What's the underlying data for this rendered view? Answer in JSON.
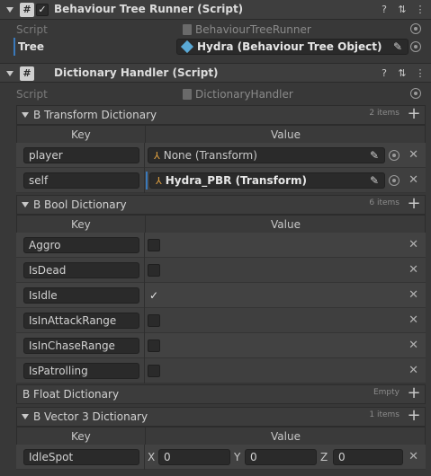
{
  "runner": {
    "title": "Behaviour Tree Runner (Script)",
    "script_label": "Script",
    "script_value": "BehaviourTreeRunner",
    "tree_label": "Tree",
    "tree_value": "Hydra (Behaviour Tree Object)"
  },
  "handler": {
    "title": "Dictionary Handler (Script)",
    "script_label": "Script",
    "script_value": "DictionaryHandler"
  },
  "columns": {
    "key": "Key",
    "value": "Value"
  },
  "transform_dict": {
    "title": "B Transform Dictionary",
    "count": "2 items",
    "rows": [
      {
        "key": "player",
        "value": "None (Transform)"
      },
      {
        "key": "self",
        "value": "Hydra_PBR (Transform)"
      }
    ]
  },
  "bool_dict": {
    "title": "B Bool Dictionary",
    "count": "6 items",
    "rows": [
      {
        "key": "Aggro",
        "checked": false
      },
      {
        "key": "IsDead",
        "checked": false
      },
      {
        "key": "IsIdle",
        "checked": true
      },
      {
        "key": "IsInAttackRange",
        "checked": false
      },
      {
        "key": "IsInChaseRange",
        "checked": false
      },
      {
        "key": "IsPatrolling",
        "checked": false
      }
    ]
  },
  "float_dict": {
    "title": "B Float Dictionary",
    "count": "Empty"
  },
  "vector_dict": {
    "title": "B Vector 3 Dictionary",
    "count": "1 items",
    "rows": [
      {
        "key": "IdleSpot",
        "x_label": "X",
        "x": "0",
        "y_label": "Y",
        "y": "0",
        "z_label": "Z",
        "z": "0"
      }
    ]
  },
  "icons": {
    "fold": "triangle-down-icon",
    "script": "script-hash-icon",
    "help": "help-icon",
    "presets": "sliders-icon",
    "more": "kebab-menu-icon",
    "target": "object-picker-icon",
    "pencil": "edit-pencil-icon",
    "remove": "close-icon",
    "add": "plus-icon",
    "checkmark": "check-icon"
  },
  "check_glyph": "✓"
}
